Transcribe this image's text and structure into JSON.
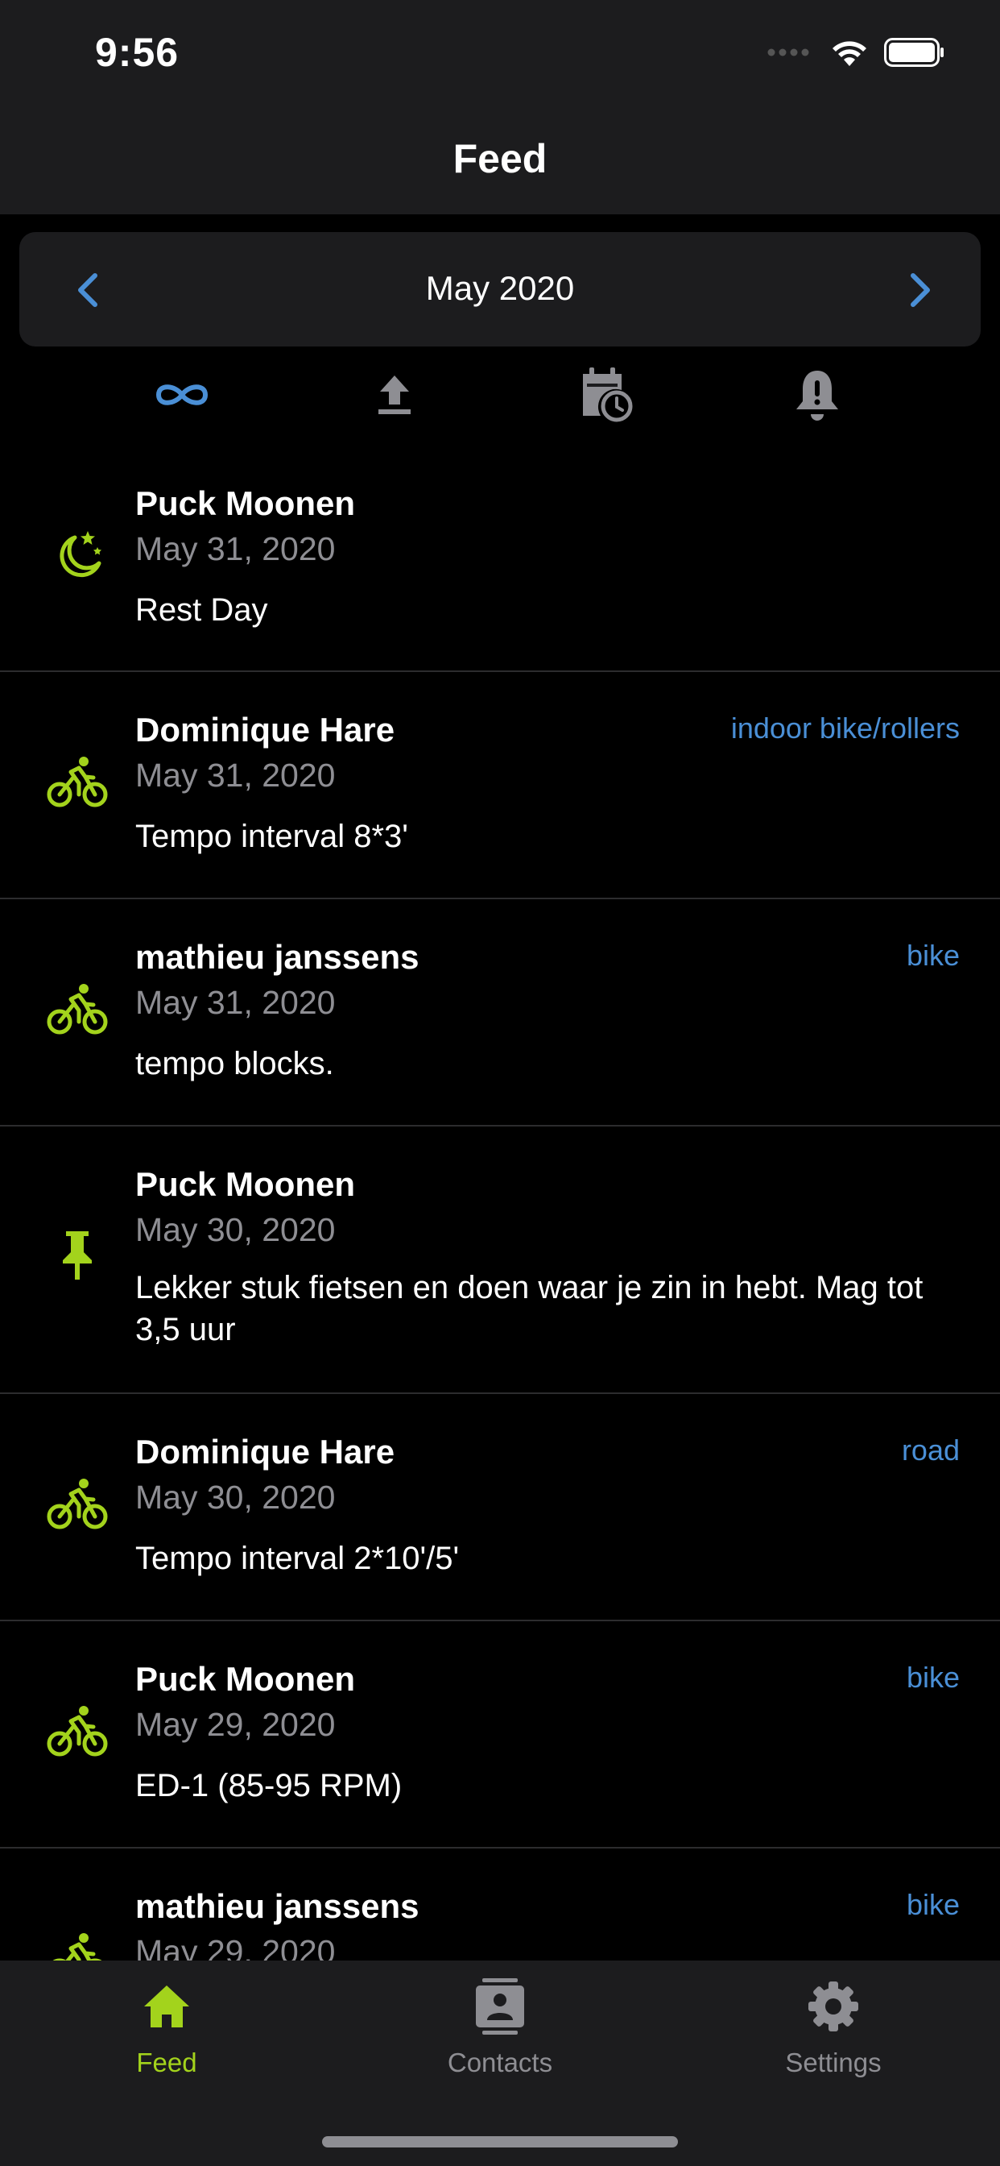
{
  "status_bar": {
    "time": "9:56"
  },
  "nav": {
    "title": "Feed"
  },
  "month_selector": {
    "label": "May 2020"
  },
  "filters": [
    {
      "icon": "infinity-icon",
      "active": true
    },
    {
      "icon": "upload-icon",
      "active": false
    },
    {
      "icon": "calendar-clock-icon",
      "active": false
    },
    {
      "icon": "bell-alert-icon",
      "active": false
    }
  ],
  "feed": {
    "items": [
      {
        "icon": "moon-stars-icon",
        "name": "Puck Moonen",
        "date": "May 31, 2020",
        "title": "Rest Day",
        "sport": ""
      },
      {
        "icon": "bike-icon",
        "name": "Dominique Hare",
        "date": "May 31, 2020",
        "title": "Tempo interval 8*3'",
        "sport": "indoor bike/rollers"
      },
      {
        "icon": "bike-icon",
        "name": "mathieu janssens",
        "date": "May 31, 2020",
        "title": "tempo blocks.",
        "sport": "bike"
      },
      {
        "icon": "pin-icon",
        "name": "Puck Moonen",
        "date": "May 30, 2020",
        "title": "Lekker stuk fietsen en doen waar je zin in hebt. Mag tot 3,5 uur",
        "sport": ""
      },
      {
        "icon": "bike-icon",
        "name": "Dominique Hare",
        "date": "May 30, 2020",
        "title": "Tempo interval 2*10'/5'",
        "sport": "road"
      },
      {
        "icon": "bike-icon",
        "name": "Puck Moonen",
        "date": "May 29, 2020",
        "title": "ED-1 (85-95 RPM)",
        "sport": "bike"
      },
      {
        "icon": "bike-icon",
        "name": "mathieu janssens",
        "date": "May 29, 2020",
        "title": "",
        "sport": "bike"
      }
    ]
  },
  "tab_bar": {
    "tabs": [
      {
        "label": "Feed",
        "icon": "home-icon",
        "active": true
      },
      {
        "label": "Contacts",
        "icon": "contacts-icon",
        "active": false
      },
      {
        "label": "Settings",
        "icon": "gear-icon",
        "active": false
      }
    ]
  },
  "colors": {
    "accent_green": "#a3d31c",
    "link_blue": "#4a8fd6",
    "inactive_gray": "#8e8e93",
    "bar_bg": "#1c1c1e"
  }
}
